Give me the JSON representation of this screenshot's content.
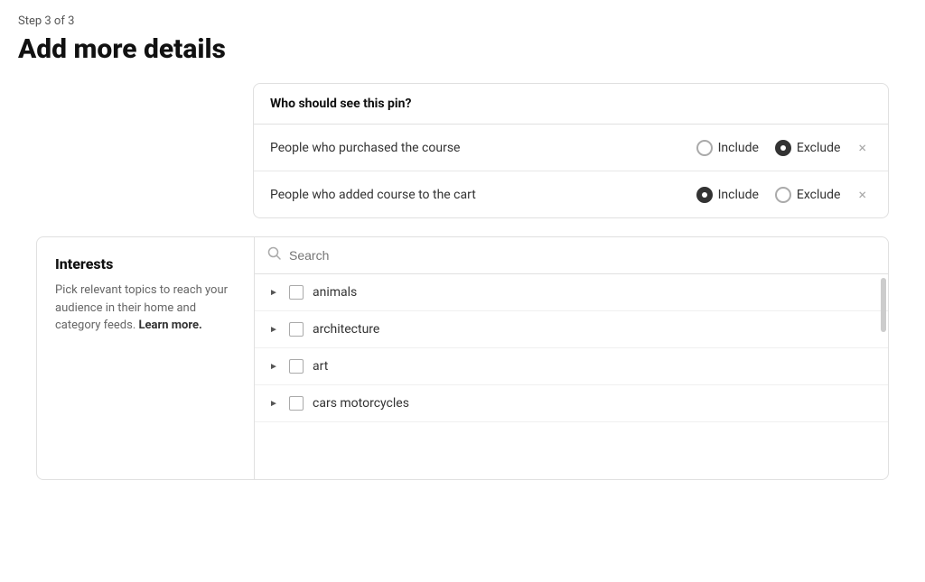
{
  "header": {
    "step_label": "Step 3 of 3",
    "page_title": "Add more details"
  },
  "audience_card": {
    "title": "Who should see this pin?",
    "rows": [
      {
        "label": "People who purchased the course",
        "include_checked": false,
        "exclude_checked": true,
        "include_label": "Include",
        "exclude_label": "Exclude"
      },
      {
        "label": "People who added course to the cart",
        "include_checked": true,
        "exclude_checked": false,
        "include_label": "Include",
        "exclude_label": "Exclude"
      }
    ]
  },
  "interests": {
    "title": "Interests",
    "description": "Pick relevant topics to reach your audience in their home and category feeds.",
    "learn_more": "Learn more.",
    "search_placeholder": "Search",
    "items": [
      {
        "label": "animals"
      },
      {
        "label": "architecture"
      },
      {
        "label": "art"
      },
      {
        "label": "cars motorcycles"
      }
    ]
  }
}
